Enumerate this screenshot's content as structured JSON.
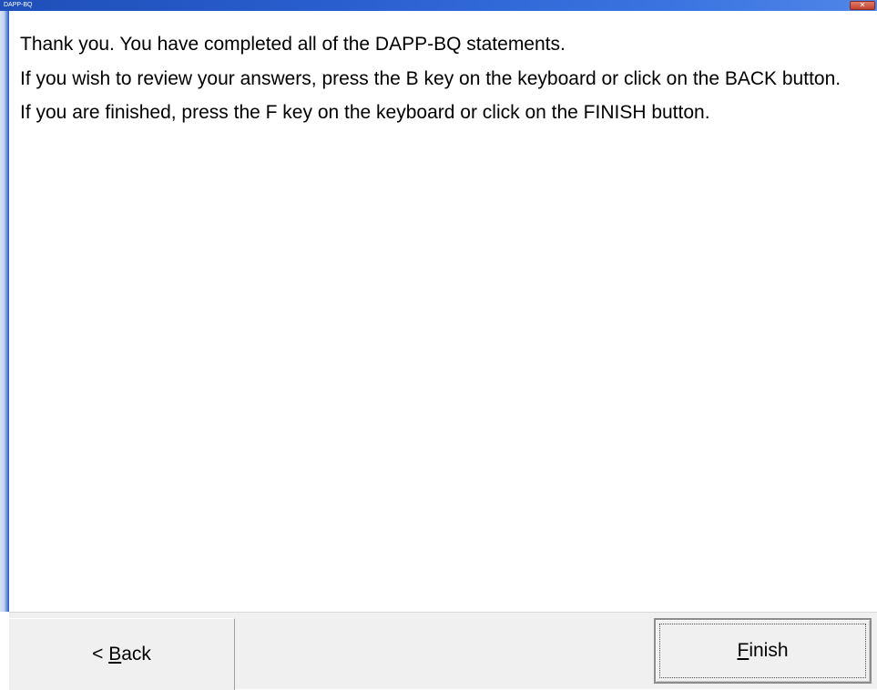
{
  "window": {
    "title": "DAPP-BQ"
  },
  "titlebar_icons": {
    "close": "close-icon"
  },
  "colors": {
    "titlebar": "#2a5fd0",
    "close_button": "#c2432f",
    "footer_background": "#f0f0f0"
  },
  "message": {
    "line1": "Thank you. You have completed all of the DAPP-BQ statements.",
    "line2": "If you wish to review your answers, press the B key on the keyboard or click on the BACK button.",
    "line3": "If you are finished, press the F key on the keyboard or click on the FINISH button."
  },
  "buttons": {
    "back": {
      "prefix": "< ",
      "accel": "B",
      "rest": "ack"
    },
    "finish": {
      "accel": "F",
      "rest": "inish"
    }
  }
}
